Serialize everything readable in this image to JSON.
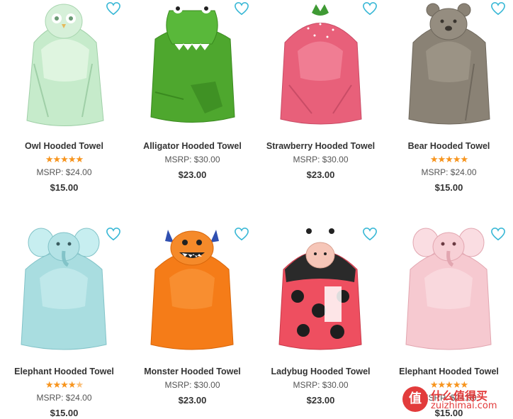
{
  "products": [
    {
      "name": "Owl Hooded Towel",
      "rating_stars": 5,
      "msrp": "MSRP: $24.00",
      "price": "$15.00",
      "color": "#b5e0bf",
      "icon": "owl-towel-image"
    },
    {
      "name": "Alligator Hooded Towel",
      "rating_stars": 0,
      "msrp": "MSRP: $30.00",
      "price": "$23.00",
      "color": "#4ea72e",
      "icon": "alligator-towel-image"
    },
    {
      "name": "Strawberry Hooded Towel",
      "rating_stars": 0,
      "msrp": "MSRP: $30.00",
      "price": "$23.00",
      "color": "#e8607a",
      "icon": "strawberry-towel-image"
    },
    {
      "name": "Bear Hooded Towel",
      "rating_stars": 5,
      "msrp": "MSRP: $24.00",
      "price": "$15.00",
      "color": "#8a8275",
      "icon": "bear-towel-image"
    },
    {
      "name": "Elephant Hooded Towel",
      "rating_stars": 4.5,
      "msrp": "MSRP: $24.00",
      "price": "$15.00",
      "color": "#a9dde0",
      "icon": "elephant-towel-image"
    },
    {
      "name": "Monster Hooded Towel",
      "rating_stars": 0,
      "msrp": "MSRP: $30.00",
      "price": "$23.00",
      "color": "#f57c18",
      "icon": "monster-towel-image"
    },
    {
      "name": "Ladybug Hooded Towel",
      "rating_stars": 0,
      "msrp": "MSRP: $30.00",
      "price": "$23.00",
      "color": "#ee4f60",
      "icon": "ladybug-towel-image"
    },
    {
      "name": "Elephant Hooded Towel",
      "rating_stars": 5,
      "msrp": "MSRP: $24.00",
      "price": "$15.00",
      "color": "#f6c9d0",
      "icon": "pink-elephant-towel-image"
    }
  ],
  "watermark": {
    "badge": "值",
    "title": "什么值得买",
    "url": "zuizhimai.com"
  },
  "colors": {
    "star": "#f7941d",
    "heart": "#39b8d6",
    "watermark": "#e23b3b"
  }
}
